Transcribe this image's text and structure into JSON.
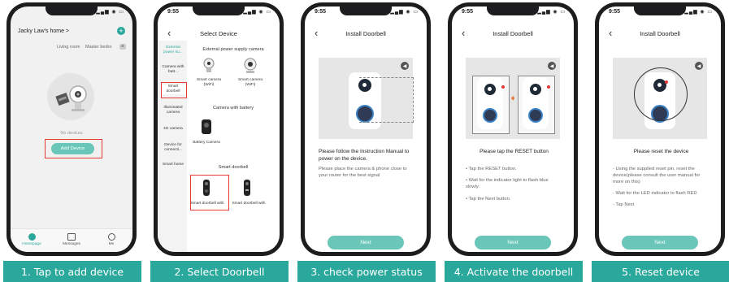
{
  "captions": [
    "1. Tap to add device",
    "2. Select Doorbell",
    "3. check power status",
    "4. Activate the doorbell",
    "5. Reset device"
  ],
  "status": {
    "time": "9:55"
  },
  "screen1": {
    "home_title": "Jacky Law's home >",
    "rooms": [
      "Living room",
      "Master bedro"
    ],
    "empty_text": "No devices",
    "add_button": "Add Device",
    "tabs": [
      "Homepage",
      "Messages",
      "Me"
    ]
  },
  "screen2": {
    "title": "Select Device",
    "categories": [
      "External power su...",
      "Camera with batt...",
      "Smart doorbell",
      "Illuminated camera",
      "4G camera",
      "Device for connecti...",
      "Smart home"
    ],
    "section_external": "External power supply camera",
    "device_external": [
      {
        "name": "Smart camera",
        "sub": "(WiFi)"
      },
      {
        "name": "Smart camera",
        "sub": "(WiFi)"
      }
    ],
    "section_battery": "Camera with battery",
    "device_battery": "Battery Camera",
    "section_doorbell": "Smart doorbell",
    "device_doorbell": [
      "Smart doorbell with",
      "Smart doorbell with"
    ]
  },
  "screen3": {
    "title": "Install Doorbell",
    "heading": "Please follow the Instruction Manual to power on the device.",
    "body": "Please place the camera & phone close to your router for the best signal",
    "next": "Next"
  },
  "screen4": {
    "title": "Install Doorbell",
    "heading": "Please tap the RESET button",
    "bullets": [
      "• Tap the RESET button.",
      "• Wait for the indicator light to flash blue slowly.",
      "• Tap the Next button."
    ],
    "next": "Next"
  },
  "screen5": {
    "title": "Install Doorbell",
    "heading": "Please reset the device",
    "bullets": [
      "- Using the supplied reset pin, reset the device(please consult the user manual for more on this)",
      "- Wait for the LED indicator to flash RED",
      "- Tap Next"
    ],
    "next": "Next"
  },
  "colors": {
    "teal": "#2aa89c",
    "button": "#69c6b9",
    "highlight": "#e53935"
  },
  "icons": [
    "plus-icon",
    "menu-icon",
    "home-tab-icon",
    "messages-tab-icon",
    "profile-tab-icon",
    "back-icon",
    "speaker-icon",
    "arrow-right-icon"
  ]
}
